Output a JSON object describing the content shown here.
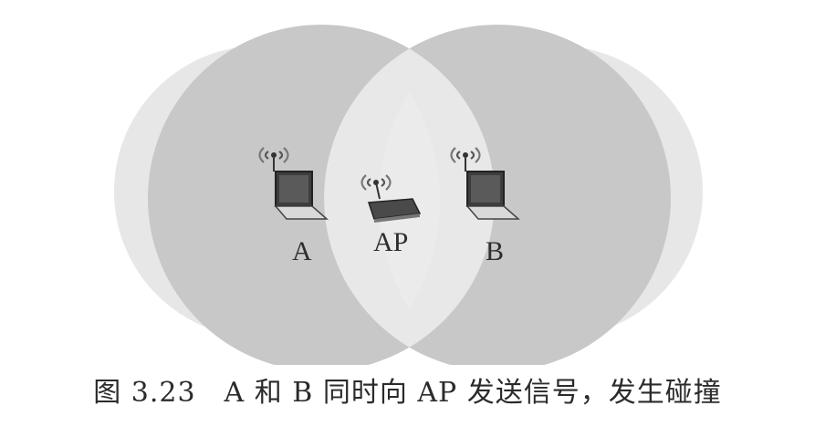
{
  "diagram": {
    "nodes": [
      {
        "id": "A",
        "label": "A",
        "device": "laptop-icon"
      },
      {
        "id": "AP",
        "label": "AP",
        "device": "access-point-icon"
      },
      {
        "id": "B",
        "label": "B",
        "device": "laptop-icon"
      }
    ],
    "coverage_colors": {
      "outer": "#e6e6e6",
      "overlap": "#c9c9c9",
      "lens": "#e9e9e9"
    }
  },
  "caption": "图 3.23　A 和 B 同时向 AP 发送信号，发生碰撞"
}
